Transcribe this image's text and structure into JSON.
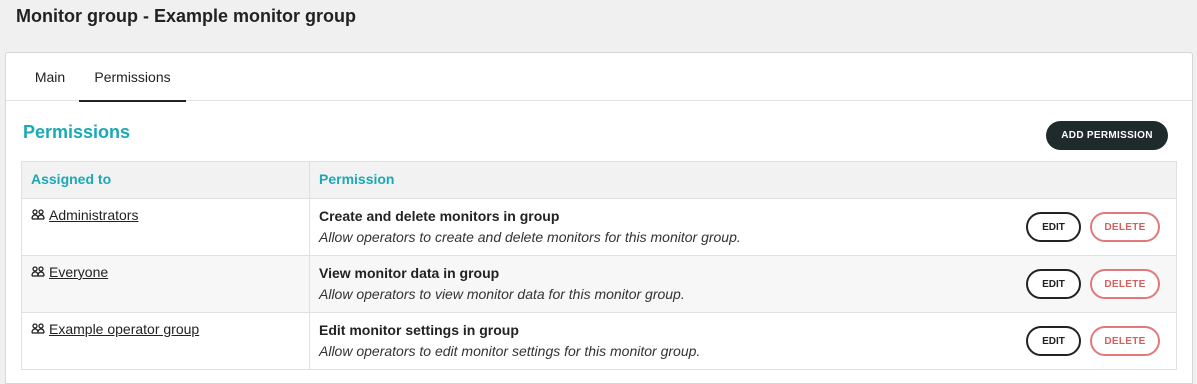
{
  "page": {
    "title": "Monitor group - Example monitor group"
  },
  "tabs": [
    {
      "label": "Main"
    },
    {
      "label": "Permissions",
      "active": true
    }
  ],
  "section": {
    "title": "Permissions",
    "add_button": "ADD PERMISSION"
  },
  "table": {
    "headers": {
      "assigned_to": "Assigned to",
      "permission": "Permission"
    },
    "rows": [
      {
        "assigned_to": "Administrators",
        "permission_name": "Create and delete monitors in group",
        "permission_desc": "Allow operators to create and delete monitors for this monitor group.",
        "edit_label": "EDIT",
        "delete_label": "DELETE"
      },
      {
        "assigned_to": "Everyone",
        "permission_name": "View monitor data in group",
        "permission_desc": "Allow operators to view monitor data for this monitor group.",
        "edit_label": "EDIT",
        "delete_label": "DELETE"
      },
      {
        "assigned_to": "Example operator group",
        "permission_name": "Edit monitor settings in group",
        "permission_desc": "Allow operators to edit monitor settings for this monitor group.",
        "edit_label": "EDIT",
        "delete_label": "DELETE"
      }
    ]
  },
  "colors": {
    "accent": "#1aa9b5",
    "dark_button": "#1e2a2c",
    "delete": "#d35f5f"
  },
  "icons": {
    "group": "group-icon"
  }
}
